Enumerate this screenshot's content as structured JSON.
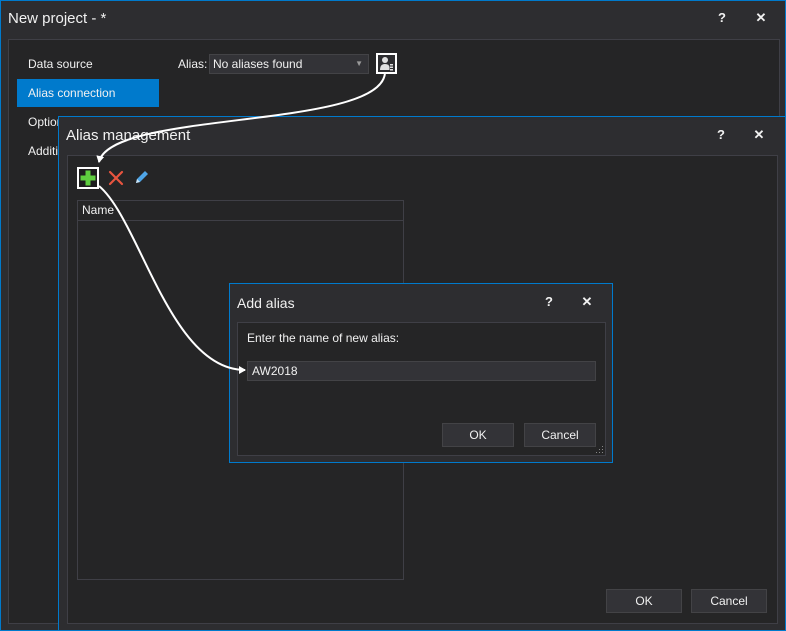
{
  "project_window": {
    "title": "New project - *",
    "help_label": "?",
    "close_label": "✕",
    "nav": [
      {
        "label": "Data source"
      },
      {
        "label": "Alias connection"
      },
      {
        "label": "Options"
      },
      {
        "label": "Additional"
      }
    ],
    "alias_label": "Alias:",
    "alias_value": "No aliases found",
    "manage_aliases_icon": "user-settings-icon"
  },
  "alias_window": {
    "title": "Alias management",
    "help_label": "?",
    "close_label": "✕",
    "toolbar": {
      "add_icon": "plus-icon",
      "delete_icon": "x-icon",
      "edit_icon": "pencil-icon"
    },
    "grid_header": "Name",
    "ok_label": "OK",
    "cancel_label": "Cancel"
  },
  "add_alias_dialog": {
    "title": "Add alias",
    "help_label": "?",
    "close_label": "✕",
    "prompt": "Enter the name of new alias:",
    "input_value": "AW2018",
    "ok_label": "OK",
    "cancel_label": "Cancel"
  },
  "colors": {
    "accent": "#007acc",
    "window_bg": "#2d2d30",
    "panel_bg": "#252526",
    "add_green": "#5fcf3f",
    "delete_red": "#e8543f",
    "edit_blue": "#4fa6e8"
  }
}
